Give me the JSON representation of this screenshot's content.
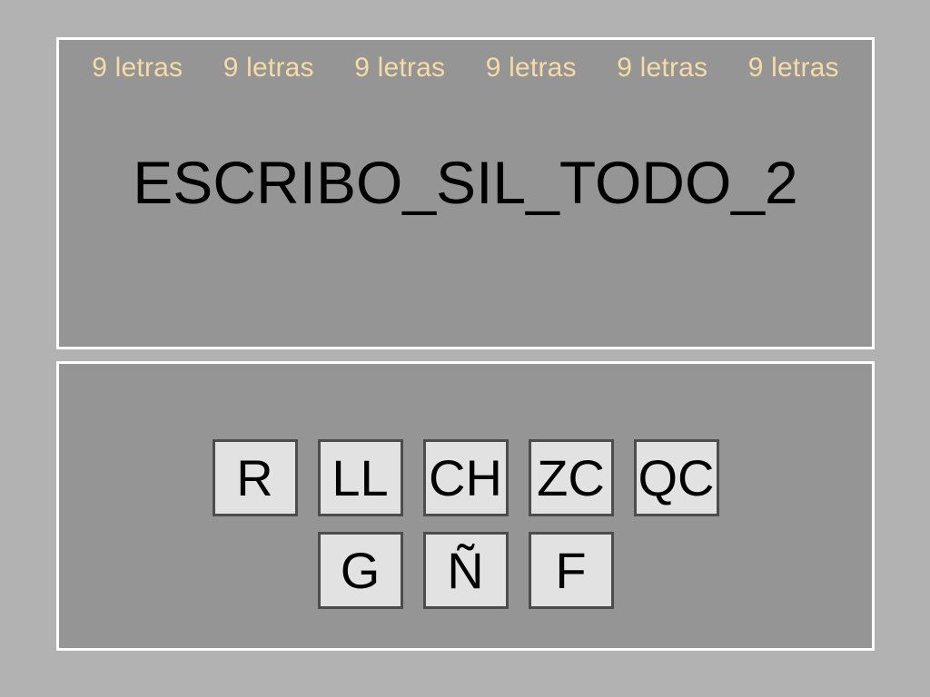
{
  "slide": {
    "background_color": "#b2b2b2",
    "panel_color": "#959595",
    "panel_border_color": "#ffffff"
  },
  "header": {
    "label_color": "#f6dba4",
    "labels": [
      "9 letras",
      "9 letras",
      "9 letras",
      "9 letras",
      "9 letras",
      "9 letras"
    ]
  },
  "title": {
    "text": "ESCRIBO_SIL_TODO_2",
    "color": "#000000"
  },
  "letters": {
    "tile_fill": "#e2e2e2",
    "tile_border": "#4c4c4c",
    "tile_text_color": "#000000",
    "rows": [
      {
        "tiles": [
          "R",
          "LL",
          "CH",
          "ZC",
          "QC"
        ]
      },
      {
        "tiles": [
          "G",
          "Ñ",
          "F"
        ]
      }
    ]
  }
}
